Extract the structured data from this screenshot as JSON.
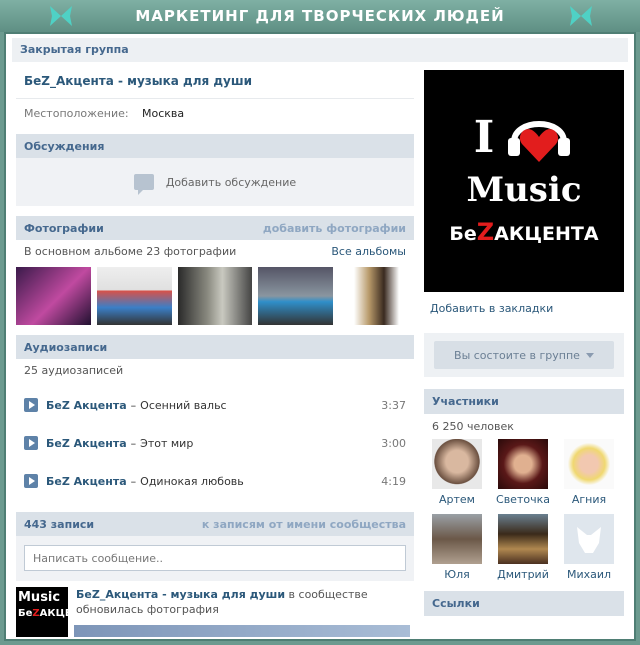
{
  "banner": {
    "title": "МАРКЕТИНГ ДЛЯ ТВОРЧЕСКИХ ЛЮДЕЙ"
  },
  "group": {
    "type_label": "Закрытая группа",
    "name": "БеZ_Акцента - музыка для души",
    "location_label": "Местоположение:",
    "location_value": "Москва"
  },
  "discussions": {
    "header": "Обсуждения",
    "add_label": "Добавить обсуждение"
  },
  "photos": {
    "header": "Фотографии",
    "add_link": "добавить фотографии",
    "album_info": "В основном альбоме 23 фотографии",
    "all_albums": "Все альбомы"
  },
  "audio": {
    "header": "Аудиозаписи",
    "count": "25 аудиозаписей",
    "tracks": [
      {
        "artist": "БеZ Акцента",
        "dash": "–",
        "title": "Осенний вальс",
        "duration": "3:37"
      },
      {
        "artist": "БеZ Акцента",
        "dash": "–",
        "title": "Этот мир",
        "duration": "3:00"
      },
      {
        "artist": "БеZ Акцента",
        "dash": "–",
        "title": "Одинокая любовь",
        "duration": "4:19"
      }
    ]
  },
  "wall": {
    "header": "443 записи",
    "community_link": "к записям от имени сообщества",
    "placeholder": "Написать сообщение..",
    "post": {
      "author": "БеZ_Акцента - музыка для души",
      "text_suffix": " в сообществе",
      "text_line2": "обновилась фотография",
      "thumb_line1": "Music",
      "thumb_line2a": "Бе",
      "thumb_line2b": "Z",
      "thumb_line2c": "АКЦЕ"
    }
  },
  "cover": {
    "big_i": "I",
    "music": "Music",
    "brand_a": "Бе",
    "brand_z": "Z",
    "brand_b": "АКЦЕНТА"
  },
  "sidebar": {
    "bookmark": "Добавить в закладки",
    "member_button": "Вы состоите в группе",
    "members_header": "Участники",
    "members_count": "6 250 человек",
    "members": [
      {
        "name": "Артем"
      },
      {
        "name": "Светочка"
      },
      {
        "name": "Агния"
      },
      {
        "name": "Юля"
      },
      {
        "name": "Дмитрий"
      },
      {
        "name": "Михаил"
      }
    ],
    "links_header": "Ссылки"
  },
  "colors": {
    "accent": "#2b587a",
    "header_bg": "#dae1e8",
    "brand_red": "#e21d1d",
    "frame": "#6c9a8f"
  }
}
